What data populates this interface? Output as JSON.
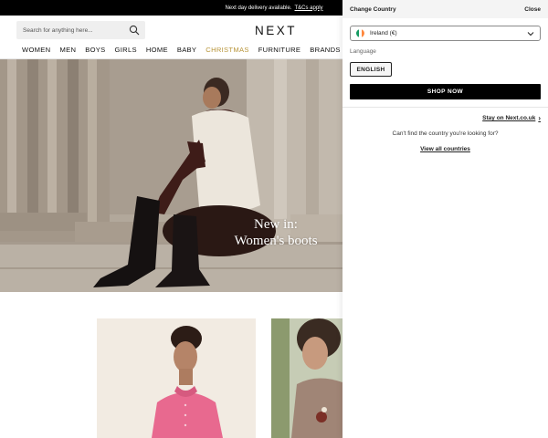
{
  "promo": {
    "text": "Next day delivery available.",
    "link": "T&Cs apply"
  },
  "header": {
    "search_placeholder": "Search for anything here...",
    "logo": "NEXT",
    "nav": [
      "WOMEN",
      "MEN",
      "BOYS",
      "GIRLS",
      "HOME",
      "BABY",
      "CHRISTMAS",
      "FURNITURE",
      "BRANDS"
    ]
  },
  "hero": {
    "line1": "New in:",
    "line2": "Women's boots"
  },
  "panel": {
    "title": "Change Country",
    "close": "Close",
    "country": "Ireland (€)",
    "language_label": "Language",
    "language_button": "ENGLISH",
    "shop_button": "SHOP NOW",
    "stay_link": "Stay on Next.co.uk",
    "cant_find": "Can't find the country you're looking for?",
    "view_all": "View all countries"
  },
  "colors": {
    "accent_christmas": "#b8953a",
    "button_bg": "#000000",
    "flag": [
      "#169b62",
      "#ffffff",
      "#ff883e"
    ]
  }
}
